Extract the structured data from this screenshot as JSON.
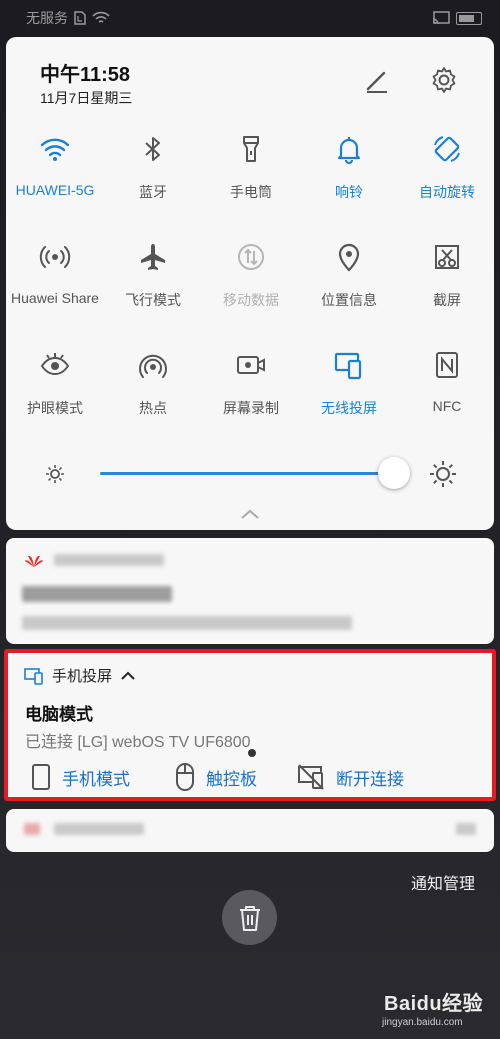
{
  "status_bar": {
    "carrier": "无服务"
  },
  "quick_settings": {
    "time": "中午11:58",
    "date": "11月7日星期三",
    "tiles": [
      {
        "label": "HUAWEI-5G",
        "icon": "wifi-icon",
        "state": "active"
      },
      {
        "label": "蓝牙",
        "icon": "bluetooth-icon",
        "state": "off"
      },
      {
        "label": "手电筒",
        "icon": "flashlight-icon",
        "state": "off"
      },
      {
        "label": "响铃",
        "icon": "bell-icon",
        "state": "active"
      },
      {
        "label": "自动旋转",
        "icon": "auto-rotate-icon",
        "state": "active"
      },
      {
        "label": "Huawei Share",
        "icon": "huawei-share-icon",
        "state": "off"
      },
      {
        "label": "飞行模式",
        "icon": "airplane-icon",
        "state": "off"
      },
      {
        "label": "移动数据",
        "icon": "mobile-data-icon",
        "state": "disabled"
      },
      {
        "label": "位置信息",
        "icon": "location-icon",
        "state": "off"
      },
      {
        "label": "截屏",
        "icon": "screenshot-icon",
        "state": "off"
      },
      {
        "label": "护眼模式",
        "icon": "eye-comfort-icon",
        "state": "off"
      },
      {
        "label": "热点",
        "icon": "hotspot-icon",
        "state": "off"
      },
      {
        "label": "屏幕录制",
        "icon": "screen-record-icon",
        "state": "off"
      },
      {
        "label": "无线投屏",
        "icon": "wireless-projection-icon",
        "state": "active"
      },
      {
        "label": "NFC",
        "icon": "nfc-icon",
        "state": "off"
      }
    ],
    "brightness_level": 0.98
  },
  "projection_card": {
    "title": "手机投屏",
    "mode": "电脑模式",
    "connected": "已连接 [LG] webOS TV UF6800",
    "actions": [
      {
        "label": "手机模式",
        "icon": "phone-mode-icon"
      },
      {
        "label": "触控板",
        "icon": "mouse-icon"
      },
      {
        "label": "断开连接",
        "icon": "disconnect-cast-icon"
      }
    ]
  },
  "footer": {
    "notification_manage": "通知管理"
  },
  "watermark": {
    "main": "Baidu经验",
    "sub": "jingyan.baidu.com"
  },
  "colors": {
    "accent": "#1a7fd6",
    "highlight_border": "#e31b23",
    "panel": "#f7f7f7"
  }
}
